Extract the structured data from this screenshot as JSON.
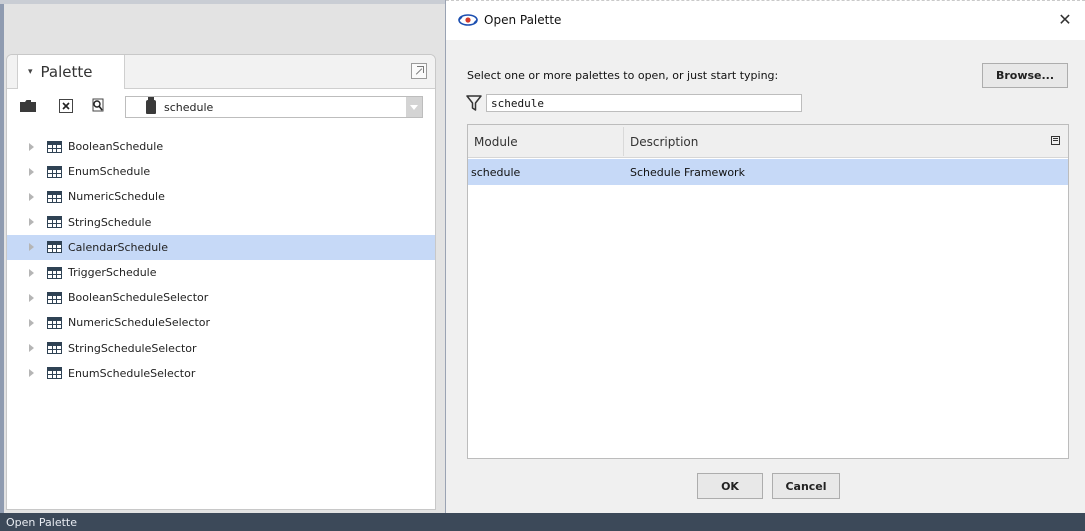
{
  "palette": {
    "title": "Palette",
    "module_value": "schedule",
    "items": [
      {
        "label": "BooleanSchedule"
      },
      {
        "label": "EnumSchedule"
      },
      {
        "label": "NumericSchedule"
      },
      {
        "label": "StringSchedule"
      },
      {
        "label": "CalendarSchedule",
        "selected": true
      },
      {
        "label": "TriggerSchedule"
      },
      {
        "label": "BooleanScheduleSelector"
      },
      {
        "label": "NumericScheduleSelector"
      },
      {
        "label": "StringScheduleSelector"
      },
      {
        "label": "EnumScheduleSelector"
      }
    ],
    "icons": {
      "folder": "folder-icon",
      "close": "close-icon",
      "search": "search-icon",
      "item": "table-icon",
      "module": "jar-icon"
    }
  },
  "dialog": {
    "title": "Open Palette",
    "close_glyph": "✕",
    "prompt": "Select one or more palettes to open, or just start typing:",
    "browse_label": "Browse...",
    "filter_value": "schedule",
    "columns": {
      "module": "Module",
      "description": "Description"
    },
    "rows": [
      {
        "module": "schedule",
        "description": "Schedule Framework",
        "selected": true
      }
    ],
    "ok_label": "OK",
    "cancel_label": "Cancel"
  },
  "status_bar": {
    "text": "Open Palette"
  },
  "colors": {
    "selection": "#c6d9f7",
    "status_bar": "#3c4959",
    "panel_bg": "#e3e3e3",
    "dialog_bg": "#f0f0f0"
  }
}
